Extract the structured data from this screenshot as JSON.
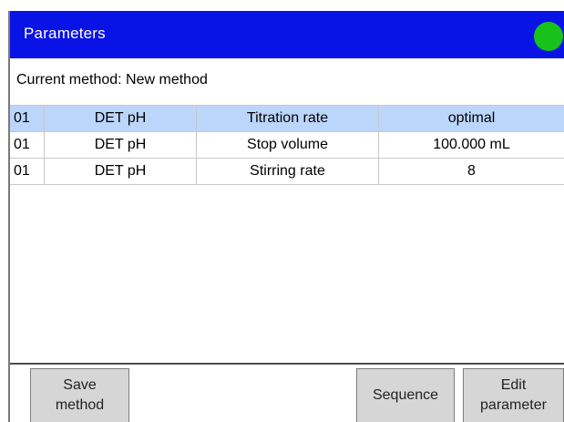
{
  "titlebar": {
    "title": "Parameters",
    "status_color": "#18c21a"
  },
  "method": {
    "label": "Current method: New method"
  },
  "table": {
    "rows": [
      {
        "no": "01",
        "command": "DET pH",
        "parameter": "Titration rate",
        "value": "optimal",
        "selected": true
      },
      {
        "no": "01",
        "command": "DET pH",
        "parameter": "Stop volume",
        "value": "100.000 mL",
        "selected": false
      },
      {
        "no": "01",
        "command": "DET pH",
        "parameter": "Stirring rate",
        "value": "8",
        "selected": false
      }
    ]
  },
  "buttons": {
    "save": "Save\nmethod",
    "sequence": "Sequence",
    "edit": "Edit\nparameter"
  }
}
